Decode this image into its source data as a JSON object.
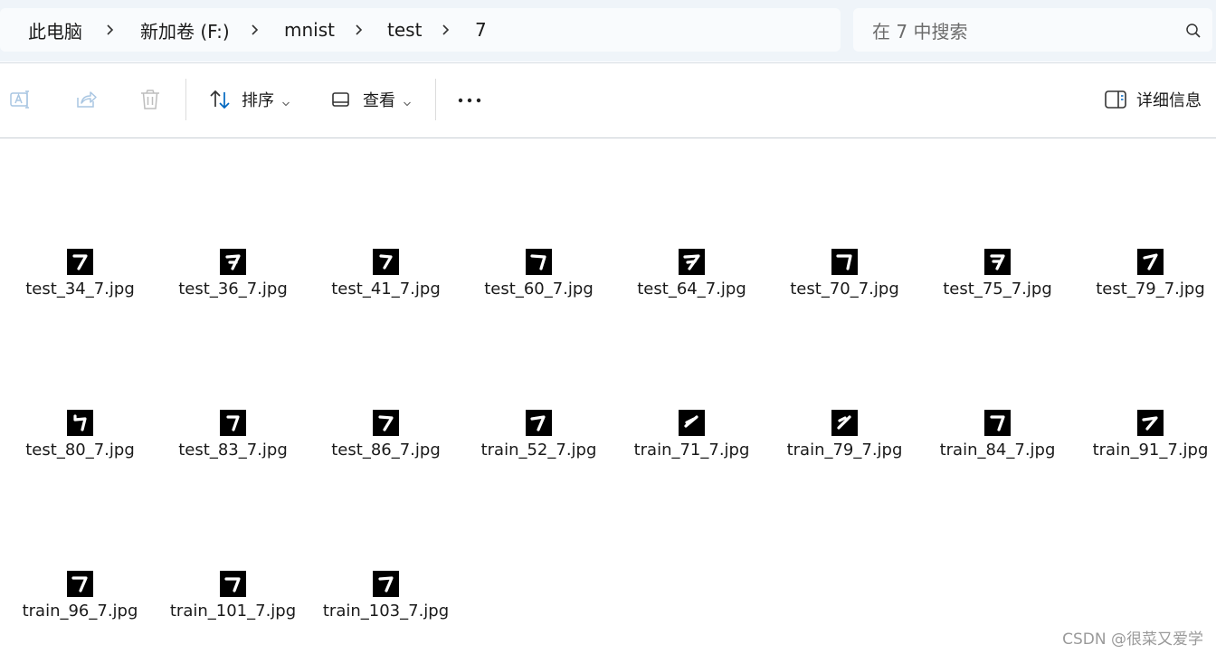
{
  "breadcrumb": {
    "items": [
      "此电脑",
      "新加卷 (F:)",
      "mnist",
      "test",
      "7"
    ]
  },
  "search": {
    "placeholder": "在 7 中搜索"
  },
  "commandbar": {
    "sort_label": "排序",
    "view_label": "查看",
    "details_label": "详细信息"
  },
  "files": [
    {
      "name": "test_34_7.jpg"
    },
    {
      "name": "test_36_7.jpg"
    },
    {
      "name": "test_41_7.jpg"
    },
    {
      "name": "test_60_7.jpg"
    },
    {
      "name": "test_64_7.jpg"
    },
    {
      "name": "test_70_7.jpg"
    },
    {
      "name": "test_75_7.jpg"
    },
    {
      "name": "test_79_7.jpg"
    },
    {
      "name": "test_80_7.jpg"
    },
    {
      "name": "test_83_7.jpg"
    },
    {
      "name": "test_86_7.jpg"
    },
    {
      "name": "train_52_7.jpg"
    },
    {
      "name": "train_71_7.jpg"
    },
    {
      "name": "train_79_7.jpg"
    },
    {
      "name": "train_84_7.jpg"
    },
    {
      "name": "train_91_7.jpg"
    },
    {
      "name": "train_96_7.jpg"
    },
    {
      "name": "train_101_7.jpg"
    },
    {
      "name": "train_103_7.jpg"
    }
  ],
  "watermark": "CSDN @很菜又爱学",
  "colors": {
    "address_bg": "#eff4f9",
    "accent": "#0067c0"
  }
}
